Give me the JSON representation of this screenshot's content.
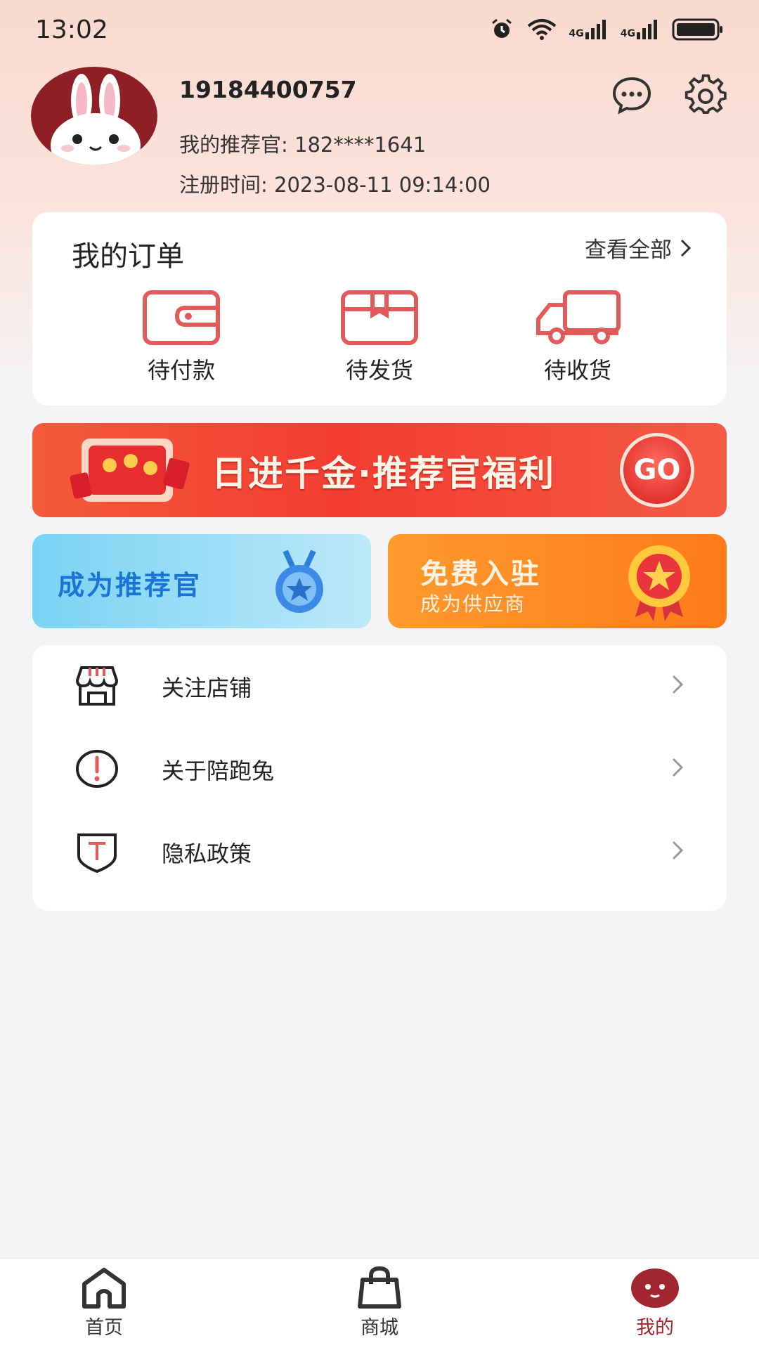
{
  "status_bar": {
    "time": "13:02",
    "network_label_1": "4G",
    "network_label_2": "4G",
    "icons": [
      "alarm-icon",
      "wifi-icon",
      "signal-icon",
      "signal-icon",
      "battery-icon"
    ]
  },
  "profile": {
    "phone": "19184400757",
    "referrer": "我的推荐官: 182****1641",
    "registered": "注册时间: 2023-08-11 09:14:00",
    "avatar_icon": "rabbit-avatar",
    "actions": [
      "message-icon",
      "gear-icon"
    ]
  },
  "orders": {
    "title": "我的订单",
    "view_all": "查看全部",
    "items": [
      {
        "label": "待付款",
        "icon": "wallet-icon"
      },
      {
        "label": "待发货",
        "icon": "package-icon"
      },
      {
        "label": "待收货",
        "icon": "truck-icon"
      }
    ]
  },
  "promo_banner": {
    "text": "日进千金·推荐官福利",
    "go_label": "GO"
  },
  "tiles": {
    "referrer_text": "成为推荐官",
    "supplier_title": "免费入驻",
    "supplier_subtitle": "成为供应商"
  },
  "menu": {
    "items": [
      {
        "label": "关注店铺",
        "icon": "store-icon"
      },
      {
        "label": "关于陪跑兔",
        "icon": "info-icon"
      },
      {
        "label": "隐私政策",
        "icon": "shield-icon"
      }
    ]
  },
  "tab_bar": {
    "tabs": [
      {
        "label": "首页",
        "icon": "home-icon"
      },
      {
        "label": "商城",
        "icon": "bag-icon"
      },
      {
        "label": "我的",
        "icon": "profile-icon"
      }
    ],
    "active_index": 2
  },
  "colors": {
    "accent": "#a12630",
    "header_bg": "#f9d9cf",
    "order_icon": "#e25a5a",
    "banner_red": "#f23d32",
    "tile_blue": "#7ad3f3",
    "tile_orange": "#ff8a22"
  }
}
